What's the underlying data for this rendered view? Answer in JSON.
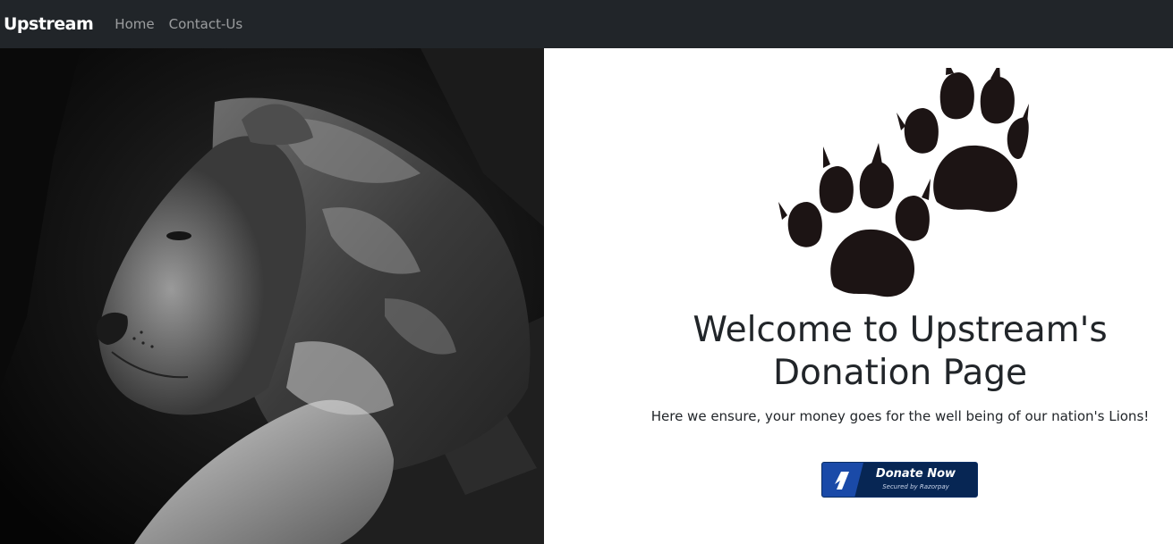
{
  "navbar": {
    "brand": "Upstream",
    "links": [
      "Home",
      "Contact-Us"
    ]
  },
  "main": {
    "image_alt": "Black and white lion resting",
    "title": "Welcome to Upstream's Donation Page",
    "subtitle": "Here we ensure, your money goes for the well being of our nation's Lions!",
    "donate_button": {
      "label": "Donate Now",
      "sublabel": "Secured by Razorpay"
    }
  },
  "colors": {
    "navbar_bg": "#212529",
    "button_bg": "#072654",
    "button_accent": "#1a4aa8",
    "text": "#212529"
  }
}
